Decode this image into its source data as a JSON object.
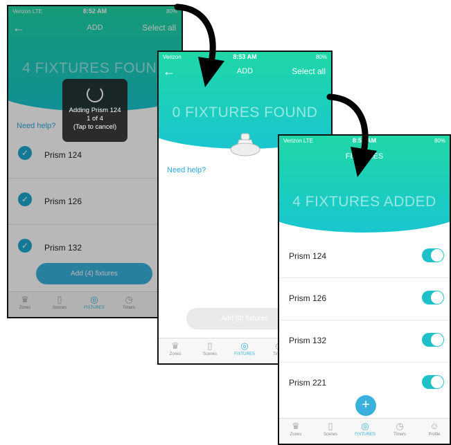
{
  "screen1": {
    "carrier": "Verizon  LTE",
    "time": "8:52 AM",
    "battery": "80%",
    "nav_title": "ADD",
    "select_all": "Select all",
    "big_title": "4 FIXTURES FOUND",
    "need_help": "Need help?",
    "toast": {
      "line1": "Adding Prism 124",
      "line2": "1 of 4",
      "line3": "(Tap to cancel)"
    },
    "rows": [
      "Prism 124",
      "Prism 126",
      "Prism 132"
    ],
    "add_button": "Add (4) fixtures"
  },
  "screen2": {
    "carrier": "Verizon",
    "time": "8:53 AM",
    "battery": "80%",
    "nav_title": "ADD",
    "select_all": "Select all",
    "big_title": "0 FIXTURES FOUND",
    "need_help": "Need help?",
    "add_button": "Add (0) fixtures"
  },
  "screen3": {
    "carrier": "Verizon  LTE",
    "time": "8:53 AM",
    "battery": "80%",
    "nav_title": "FIXTURES",
    "big_title": "4 FIXTURES ADDED",
    "rows": [
      "Prism 124",
      "Prism 126",
      "Prism 132",
      "Prism 221"
    ],
    "fab": "+"
  },
  "tabs": {
    "zones": "Zones",
    "scenes": "Scenes",
    "fixtures": "FIXTURES",
    "timers": "Timers",
    "profile": "Profile"
  },
  "colors": {
    "gradient_start": "#1fd7a6",
    "gradient_end": "#19c6cf",
    "accent": "#3ab0dc"
  }
}
